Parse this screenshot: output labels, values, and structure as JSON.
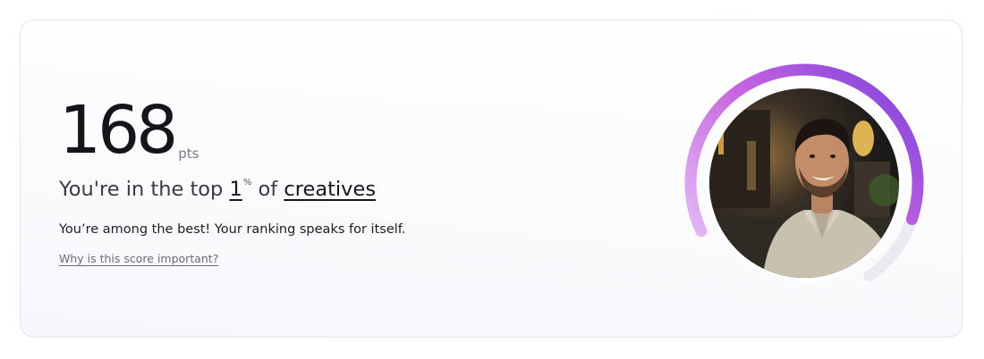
{
  "score": {
    "value": "168",
    "unit": "pts"
  },
  "ranking": {
    "prefix": "You're in the top",
    "value": "1",
    "percent_symbol": "%",
    "connector": "of",
    "category": "creatives",
    "progress_fraction": 0.86
  },
  "description": "You’re among the best! Your ranking speaks for itself.",
  "info_link": "Why is this score important?",
  "avatar": {
    "icon": "profile-photo"
  },
  "colors": {
    "ring_start": "#e2b8f4",
    "ring_mid": "#c765e0",
    "ring_end": "#8d49dc",
    "ring_track": "#ece9f2",
    "text_primary": "#14141a"
  }
}
